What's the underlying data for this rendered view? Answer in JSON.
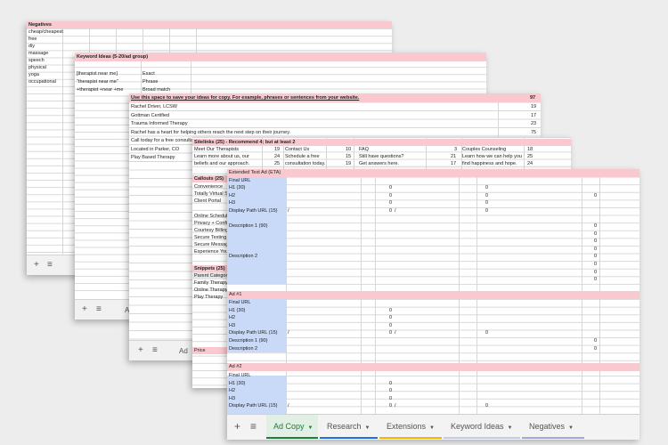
{
  "colors": {
    "pink": "#f9c9cf",
    "blue": "#c9d9f8",
    "active_tab": "#188038",
    "research_tab": "#1a73e8",
    "extensions_tab": "#f4b400",
    "keyword_tab": "#c5cae9",
    "negatives_tab": "#9fa8da"
  },
  "negatives": {
    "header": "Negatives",
    "items": [
      "cheap/cheapest",
      "free",
      "diy",
      "massage",
      "speech",
      "physical",
      "yoga",
      "occupational"
    ]
  },
  "keyword_ideas": {
    "header": "Keyword Ideas (5-20/ad group)",
    "rows": [
      {
        "kw": "[therapist near me]",
        "match": "Exact"
      },
      {
        "kw": "\"therapist near me\"",
        "match": "Phrase"
      },
      {
        "kw": "+therapist +near +me",
        "match": "Broad match"
      }
    ]
  },
  "copy_ideas": {
    "header": "Use this space to save your ideas for copy. For example, phrases or sentences from your website.",
    "header_count": "97",
    "rows": [
      {
        "t": "Rachel Driver, LCSW",
        "n": "19"
      },
      {
        "t": "Gottman Certified",
        "n": "17"
      },
      {
        "t": "Trauma Informed Therapy",
        "n": "23"
      },
      {
        "t": "Rachel has a heart for helping others reach the next step on their journey.",
        "n": "75"
      },
      {
        "t": "Call today for a free consulta",
        "n": ""
      },
      {
        "t": "Located in Parker, CO",
        "n": ""
      },
      {
        "t": "Play Based Therapy",
        "n": ""
      }
    ]
  },
  "sitelinks": {
    "header": "Sitelinks (25) - Recommend 4; but at least 2",
    "rows": [
      [
        "Meet Our Therapists",
        "19",
        "Contact Us",
        "10",
        "FAQ",
        "3",
        "Couples Counseling",
        "18"
      ],
      [
        "Learn more about us, our",
        "24",
        "Schedule a free",
        "15",
        "Still have questions?",
        "21",
        "Learn how we can help you",
        "25"
      ],
      [
        "beliefs and our approach.",
        "25",
        "consultation today.",
        "19",
        "Get answers here.",
        "17",
        "find happiness and hope.",
        "24"
      ]
    ]
  },
  "callouts": {
    "header": "Callouts (25)",
    "items": [
      "Convenience",
      "Totally Virtual S",
      "Client Portal",
      "",
      "Online Schedul",
      "Privacy + Confi",
      "Courtesy Billing",
      "Secure Texting",
      "Secure Messag",
      "Experience You"
    ]
  },
  "snippets": {
    "header": "Snippets (25)",
    "items": [
      "Parent Categor",
      "Family Therapy",
      "Online Therapy",
      "Play Therapy"
    ],
    "price": "Price"
  },
  "eta": {
    "header": "Extended Text Ad (ETA)",
    "labels": [
      "Final URL",
      "H1 (30)",
      "H2",
      "H3",
      "Display Path URL (15)",
      "",
      "Description 1 (90)",
      "",
      "",
      "",
      "",
      "Description 2",
      "",
      "",
      ""
    ]
  },
  "ad1": {
    "header": "Ad #1",
    "labels": [
      "Final URL",
      "H1 (30)",
      "H2",
      "H3",
      "Display Path URL (15)",
      "Description 1 (90)",
      "Description 2"
    ]
  },
  "ad2": {
    "header": "Ad #2",
    "labels": [
      "Final URL",
      "H1 (30)",
      "H2",
      "H3",
      "Display Path URL (15)"
    ]
  },
  "values": {
    "zero": "0",
    "slash": "/"
  },
  "tabs": [
    {
      "label": "Ad Copy"
    },
    {
      "label": "Research"
    },
    {
      "label": "Extensions"
    },
    {
      "label": "Keyword Ideas"
    },
    {
      "label": "Negatives"
    }
  ],
  "peek_tab": {
    "a": "Ad",
    "b": "A"
  }
}
